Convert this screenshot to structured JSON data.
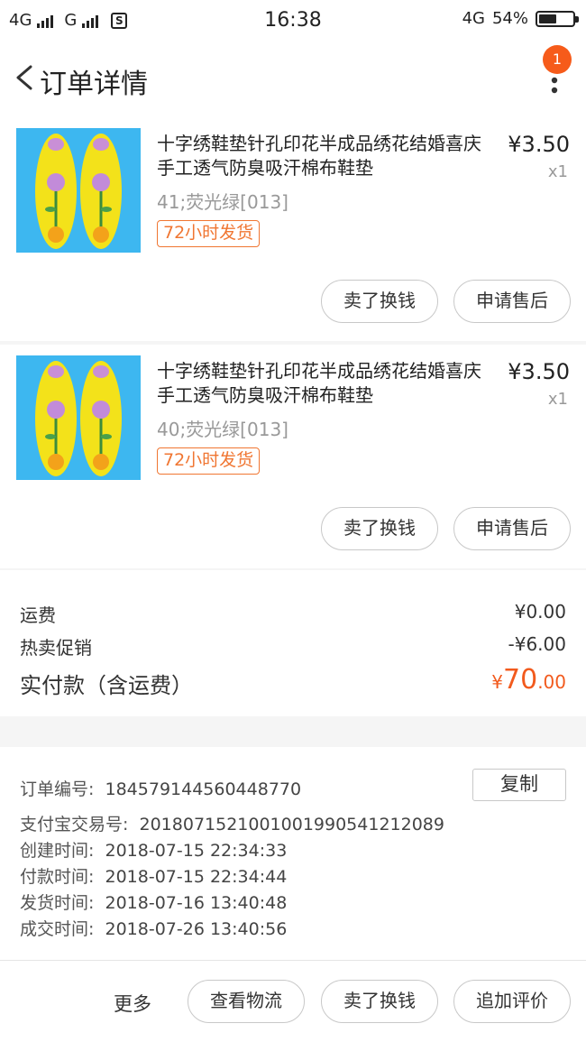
{
  "status_bar": {
    "left_net1": "4G",
    "left_net2": "G",
    "sim_label": "S",
    "time": "16:38",
    "right_net": "4G",
    "battery": "54%",
    "battery_level": 0.54
  },
  "header": {
    "title": "订单详情",
    "badge_count": "1"
  },
  "items": [
    {
      "title": "十字绣鞋垫针孔印花半成品绣花结婚喜庆手工透气防臭吸汗棉布鞋垫",
      "price": "¥3.50",
      "qty": "x1",
      "sku": "41;荧光绿[013]",
      "tag": "72小时发货",
      "btn_sell": "卖了换钱",
      "btn_service": "申请售后"
    },
    {
      "title": "十字绣鞋垫针孔印花半成品绣花结婚喜庆手工透气防臭吸汗棉布鞋垫",
      "price": "¥3.50",
      "qty": "x1",
      "sku": "40;荧光绿[013]",
      "tag": "72小时发货",
      "btn_sell": "卖了换钱",
      "btn_service": "申请售后"
    }
  ],
  "summary": {
    "shipping_label": "运费",
    "shipping_value": "¥0.00",
    "promo_label": "热卖促销",
    "promo_value": "-¥6.00",
    "total_label": "实付款（含运费）",
    "total_symbol": "¥",
    "total_int": "70",
    "total_dec": ".00"
  },
  "order_info": {
    "copy_label": "复制",
    "rows": [
      {
        "label": "订单编号:",
        "value": "184579144560448770"
      },
      {
        "label": "支付宝交易号:",
        "value": "2018071521001001990541212089"
      },
      {
        "label": "创建时间:",
        "value": "2018-07-15 22:34:33"
      },
      {
        "label": "付款时间:",
        "value": "2018-07-15 22:34:44"
      },
      {
        "label": "发货时间:",
        "value": "2018-07-16 13:40:48"
      },
      {
        "label": "成交时间:",
        "value": "2018-07-26 13:40:56"
      }
    ]
  },
  "bottom_bar": {
    "more": "更多",
    "logistics": "查看物流",
    "sell": "卖了换钱",
    "review": "追加评价"
  }
}
